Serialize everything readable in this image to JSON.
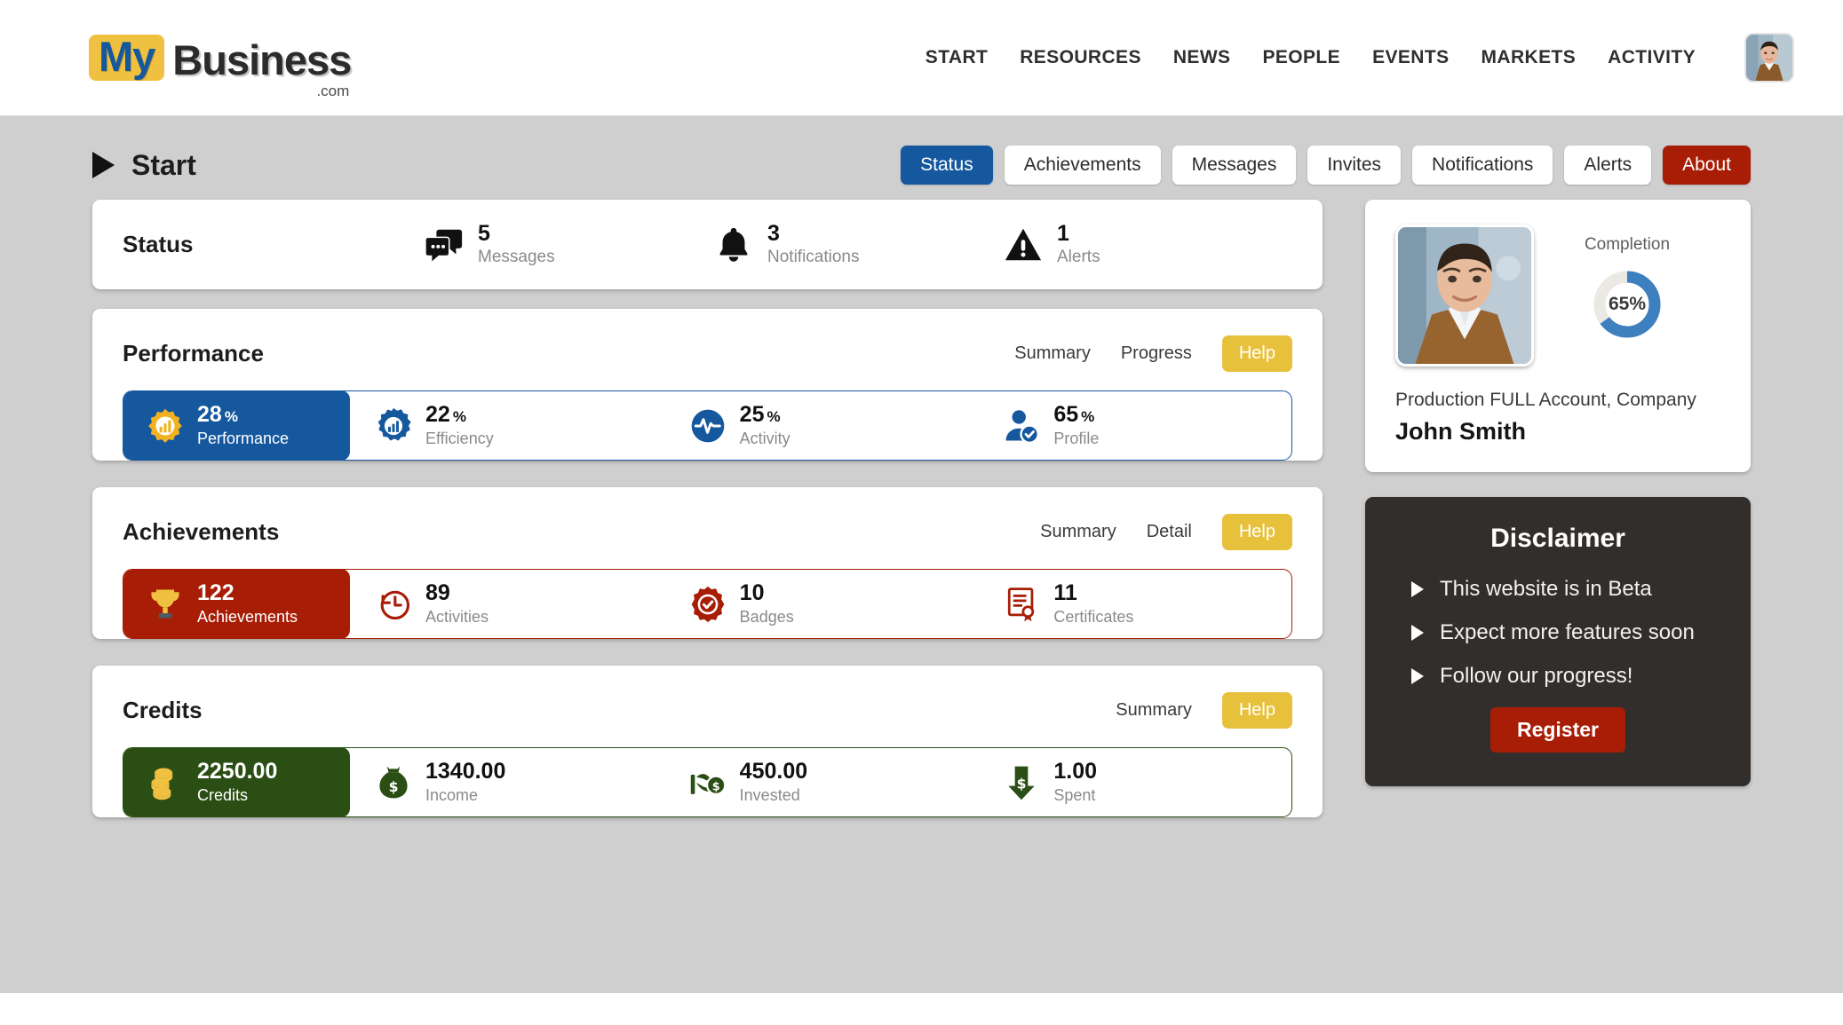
{
  "brand": {
    "my": "My",
    "business": "Business",
    "dotcom": ".com"
  },
  "nav": [
    {
      "label": "START"
    },
    {
      "label": "RESOURCES"
    },
    {
      "label": "NEWS"
    },
    {
      "label": "PEOPLE"
    },
    {
      "label": "EVENTS"
    },
    {
      "label": "MARKETS"
    },
    {
      "label": "ACTIVITY"
    }
  ],
  "page": {
    "title": "Start"
  },
  "tabs": [
    {
      "label": "Status",
      "state": "active"
    },
    {
      "label": "Achievements",
      "state": "normal"
    },
    {
      "label": "Messages",
      "state": "normal"
    },
    {
      "label": "Invites",
      "state": "normal"
    },
    {
      "label": "Notifications",
      "state": "normal"
    },
    {
      "label": "Alerts",
      "state": "normal"
    },
    {
      "label": "About",
      "state": "danger"
    }
  ],
  "status": {
    "title": "Status",
    "items": [
      {
        "value": "5",
        "label": "Messages",
        "icon": "chat-bubbles-icon"
      },
      {
        "value": "3",
        "label": "Notifications",
        "icon": "bell-icon"
      },
      {
        "value": "1",
        "label": "Alerts",
        "icon": "warning-triangle-icon"
      }
    ]
  },
  "performance": {
    "title": "Performance",
    "links": [
      "Summary",
      "Progress"
    ],
    "help": "Help",
    "accent": "#15589e",
    "metrics": [
      {
        "value": "28",
        "unit": "%",
        "label": "Performance",
        "icon": "badge-chart-icon"
      },
      {
        "value": "22",
        "unit": "%",
        "label": "Efficiency",
        "icon": "gear-chart-icon"
      },
      {
        "value": "25",
        "unit": "%",
        "label": "Activity",
        "icon": "pulse-icon"
      },
      {
        "value": "65",
        "unit": "%",
        "label": "Profile",
        "icon": "user-check-icon"
      }
    ]
  },
  "achievements": {
    "title": "Achievements",
    "links": [
      "Summary",
      "Detail"
    ],
    "help": "Help",
    "accent": "#a81d05",
    "metrics": [
      {
        "value": "122",
        "unit": "",
        "label": "Achievements",
        "icon": "trophy-icon"
      },
      {
        "value": "89",
        "unit": "",
        "label": "Activities",
        "icon": "clock-arrow-icon"
      },
      {
        "value": "10",
        "unit": "",
        "label": "Badges",
        "icon": "badge-check-icon"
      },
      {
        "value": "11",
        "unit": "",
        "label": "Certificates",
        "icon": "certificate-icon"
      }
    ]
  },
  "credits": {
    "title": "Credits",
    "links": [
      "Summary"
    ],
    "help": "Help",
    "accent": "#2a4e14",
    "metrics": [
      {
        "value": "2250.00",
        "unit": "",
        "label": "Credits",
        "icon": "coins-icon"
      },
      {
        "value": "1340.00",
        "unit": "",
        "label": "Income",
        "icon": "money-bag-icon"
      },
      {
        "value": "450.00",
        "unit": "",
        "label": "Invested",
        "icon": "hand-money-icon"
      },
      {
        "value": "1.00",
        "unit": "",
        "label": "Spent",
        "icon": "arrow-down-money-icon"
      }
    ]
  },
  "profile": {
    "completion_label": "Completion",
    "completion_value": "65%",
    "completion_percent": 65,
    "completion_color": "#3d7fbf",
    "completion_track": "#ece8e3",
    "account": "Production FULL Account, Company",
    "name": "John Smith"
  },
  "disclaimer": {
    "title": "Disclaimer",
    "items": [
      "This website is in Beta",
      "Expect more features soon",
      "Follow our progress!"
    ],
    "register": "Register",
    "bg": "#322e2b",
    "register_color": "#a81d05"
  }
}
